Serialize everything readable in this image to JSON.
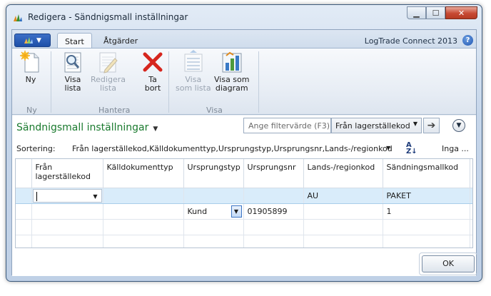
{
  "window": {
    "title": "Redigera - Sändnigsmall inställningar"
  },
  "ribbon": {
    "tabs": [
      {
        "label": "Start",
        "active": true
      },
      {
        "label": "Åtgärder",
        "active": false
      }
    ],
    "product": "LogTrade Connect 2013",
    "help": "?",
    "groups": [
      {
        "label": "Ny",
        "buttons": [
          {
            "line1": "Ny",
            "line2": "",
            "icon": "new-document-icon",
            "disabled": false
          }
        ]
      },
      {
        "label": "Hantera",
        "buttons": [
          {
            "line1": "Visa",
            "line2": "lista",
            "icon": "view-list-icon",
            "disabled": false
          },
          {
            "line1": "Redigera",
            "line2": "lista",
            "icon": "edit-list-icon",
            "disabled": true
          },
          {
            "line1": "Ta",
            "line2": "bort",
            "icon": "delete-icon",
            "disabled": false
          }
        ]
      },
      {
        "label": "Visa",
        "buttons": [
          {
            "line1": "Visa",
            "line2": "som lista",
            "icon": "show-as-list-icon",
            "disabled": true
          },
          {
            "line1": "Visa som",
            "line2": "diagram",
            "icon": "show-as-chart-icon",
            "disabled": false
          }
        ]
      }
    ]
  },
  "page": {
    "title": "Sändnigsmall inställningar",
    "filter_placeholder": "Ange filtervärde (F3)",
    "filter_field": "Från lagerställekod",
    "sort_label": "Sortering:",
    "sort_value": "Från lagerställekod,Källdokumenttyp,Ursprungstyp,Ursprungsnr,Lands-/regionkod",
    "sort_direction_glyph": "A Z",
    "sort_more": "Inga ..."
  },
  "grid": {
    "columns": [
      {
        "line1": "Från",
        "line2": "lagerställekod"
      },
      {
        "line1": "Källdokumenttyp",
        "line2": ""
      },
      {
        "line1": "Ursprungstyp",
        "line2": ""
      },
      {
        "line1": "Ursprungsnr",
        "line2": ""
      },
      {
        "line1": "Lands-/regionkod",
        "line2": ""
      },
      {
        "line1": "Sändningsmallkod",
        "line2": ""
      }
    ],
    "rows": [
      {
        "cells": [
          "",
          "",
          "",
          "",
          "AU",
          "PAKET"
        ]
      },
      {
        "cells": [
          "",
          "",
          "Kund",
          "01905899",
          "",
          "1"
        ]
      },
      {
        "cells": [
          "",
          "",
          "",
          "",
          "",
          ""
        ]
      },
      {
        "cells": [
          "",
          "",
          "",
          "",
          "",
          ""
        ]
      }
    ]
  },
  "footer": {
    "ok_label": "OK"
  },
  "colors": {
    "page_title": "#1a7a2e",
    "selection": "#d9ecfa",
    "accent": "#1d4fa8"
  }
}
